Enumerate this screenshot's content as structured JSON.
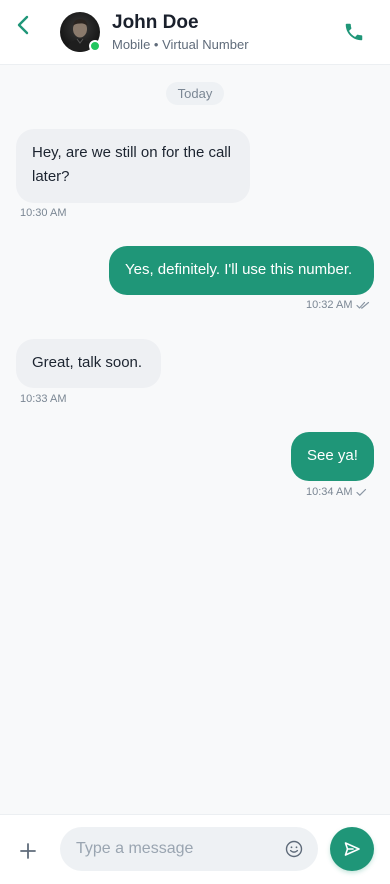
{
  "colors": {
    "accent": "#1f9678",
    "online": "#22c55e",
    "incoming_bubble": "#eef0f3",
    "background": "#f8f9fa"
  },
  "header": {
    "contact_name": "John Doe",
    "contact_subtitle": "Mobile • Virtual Number",
    "back_icon": "chevron-left-icon",
    "call_icon": "phone-icon",
    "status": "online"
  },
  "date_separator": "Today",
  "messages": [
    {
      "direction": "incoming",
      "text": "Hey, are we still on for the call later?",
      "time": "10:30 AM"
    },
    {
      "direction": "outgoing",
      "text": "Yes, definitely. I'll use this number.",
      "time": "10:32 AM",
      "receipt": "read"
    },
    {
      "direction": "incoming",
      "text": "Great, talk soon.",
      "time": "10:33 AM"
    },
    {
      "direction": "outgoing",
      "text": "See ya!",
      "time": "10:34 AM",
      "receipt": "sent"
    }
  ],
  "composer": {
    "placeholder": "Type a message",
    "value": "",
    "attach_icon": "plus-icon",
    "emoji_icon": "smiley-icon",
    "send_icon": "send-icon"
  }
}
